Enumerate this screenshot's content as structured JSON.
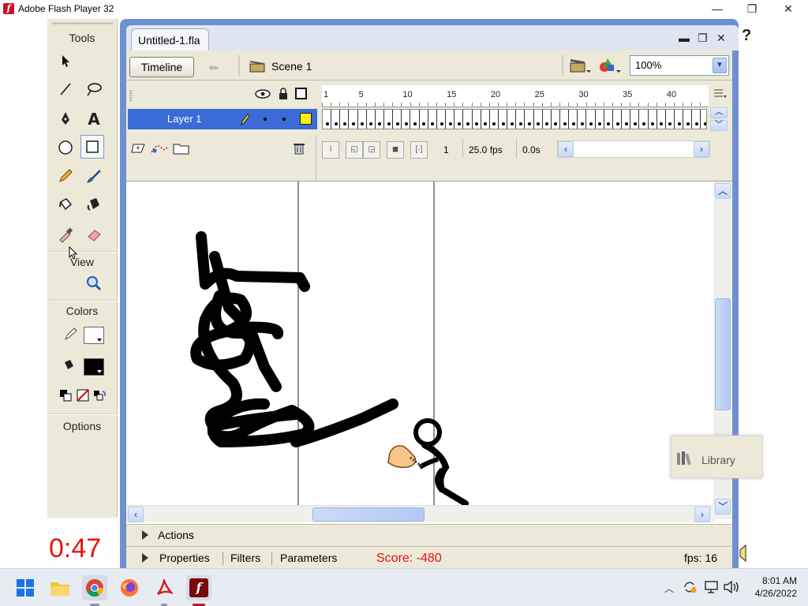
{
  "window": {
    "title": "Adobe Flash Player 32",
    "controls": [
      "—",
      "❐",
      "✕"
    ]
  },
  "tools": {
    "heading": "Tools",
    "items": [
      "selection-tool",
      "subselection-tool",
      "line-tool",
      "lasso-tool",
      "pen-tool",
      "text-tool",
      "oval-tool",
      "rectangle-tool",
      "pencil-tool",
      "brush-tool",
      "ink-bottle-tool",
      "paint-bucket-tool",
      "eyedropper-tool",
      "eraser-tool"
    ],
    "view_heading": "View",
    "colors_heading": "Colors",
    "options_heading": "Options"
  },
  "document": {
    "tab_title": "Untitled-1.fla",
    "controls": [
      "▬",
      "❐",
      "✕"
    ],
    "timeline_button": "Timeline",
    "scene_label": "Scene 1",
    "zoom": "100%"
  },
  "timeline": {
    "ruler_labels": [
      "1",
      "5",
      "10",
      "15",
      "20",
      "25",
      "30",
      "35",
      "40"
    ],
    "layer_name": "Layer 1",
    "current_frame": "1",
    "fps": "25.0 fps",
    "elapsed": "0.0s"
  },
  "panels": {
    "actions_label": "Actions",
    "tabs": [
      "Properties",
      "Filters",
      "Parameters"
    ],
    "score": "Score: -480",
    "fps_readout": "fps: 16"
  },
  "library": {
    "label": "Library"
  },
  "overlay": {
    "timer": "0:47"
  },
  "help": "?",
  "taskbar": {
    "apps": [
      "start-icon",
      "file-explorer-icon",
      "chrome-icon",
      "firefox-icon",
      "acrobat-icon",
      "flash-icon"
    ],
    "time": "8:01 AM",
    "date": "4/26/2022"
  },
  "colors": {
    "layer_highlight": "#3a6bd6",
    "score_text": "#e11",
    "fill_swatch": "#000000"
  }
}
